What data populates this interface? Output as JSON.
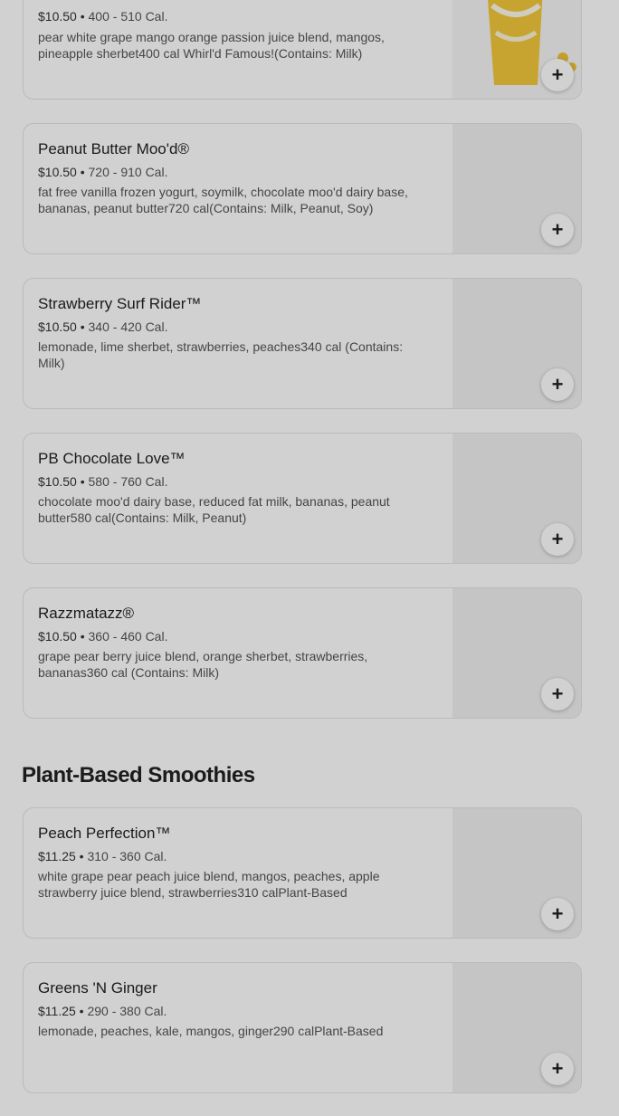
{
  "items": [
    {
      "price": "$10.50",
      "calories": "400 - 510 Cal.",
      "description": "pear white grape mango orange passion juice blend, mangos, pineapple sherbet400 cal Whirl'd Famous!(Contains: Milk)",
      "add_label": "+"
    },
    {
      "name": "Peanut Butter Moo'd®",
      "price": "$10.50",
      "calories": "720 - 910 Cal.",
      "description": "fat free vanilla frozen yogurt, soymilk, chocolate moo'd dairy base, bananas, peanut butter720 cal(Contains: Milk, Peanut, Soy)",
      "add_label": "+"
    },
    {
      "name": "Strawberry Surf Rider™",
      "price": "$10.50",
      "calories": "340 - 420 Cal.",
      "description": "lemonade, lime sherbet, strawberries, peaches340 cal (Contains: Milk)",
      "add_label": "+"
    },
    {
      "name": "PB Chocolate Love™",
      "price": "$10.50",
      "calories": "580 - 760 Cal.",
      "description": "chocolate moo'd dairy base, reduced fat milk, bananas, peanut butter580 cal(Contains: Milk, Peanut)",
      "add_label": "+"
    },
    {
      "name": "Razzmatazz®",
      "price": "$10.50",
      "calories": "360 - 460 Cal.",
      "description": "grape pear berry juice blend, orange sherbet, strawberries, bananas360 cal (Contains: Milk)",
      "add_label": "+"
    }
  ],
  "plant_section": {
    "title": "Plant-Based Smoothies",
    "items": [
      {
        "name": "Peach Perfection™",
        "price": "$11.25",
        "calories": "310 - 360 Cal.",
        "description": "white grape pear peach juice blend, mangos, peaches, apple strawberry juice blend, strawberries310 calPlant-Based",
        "add_label": "+"
      },
      {
        "name": "Greens 'N Ginger",
        "price": "$11.25",
        "calories": "290 - 380 Cal.",
        "description": "lemonade, peaches, kale, mangos, ginger290 calPlant-Based",
        "add_label": "+"
      }
    ]
  },
  "separator": "•",
  "colors": {
    "overlay": "#000000",
    "card_border": "#e3e3e3",
    "image_placeholder": "#f1f1f1",
    "cup_yellow": "#f3c93b"
  }
}
